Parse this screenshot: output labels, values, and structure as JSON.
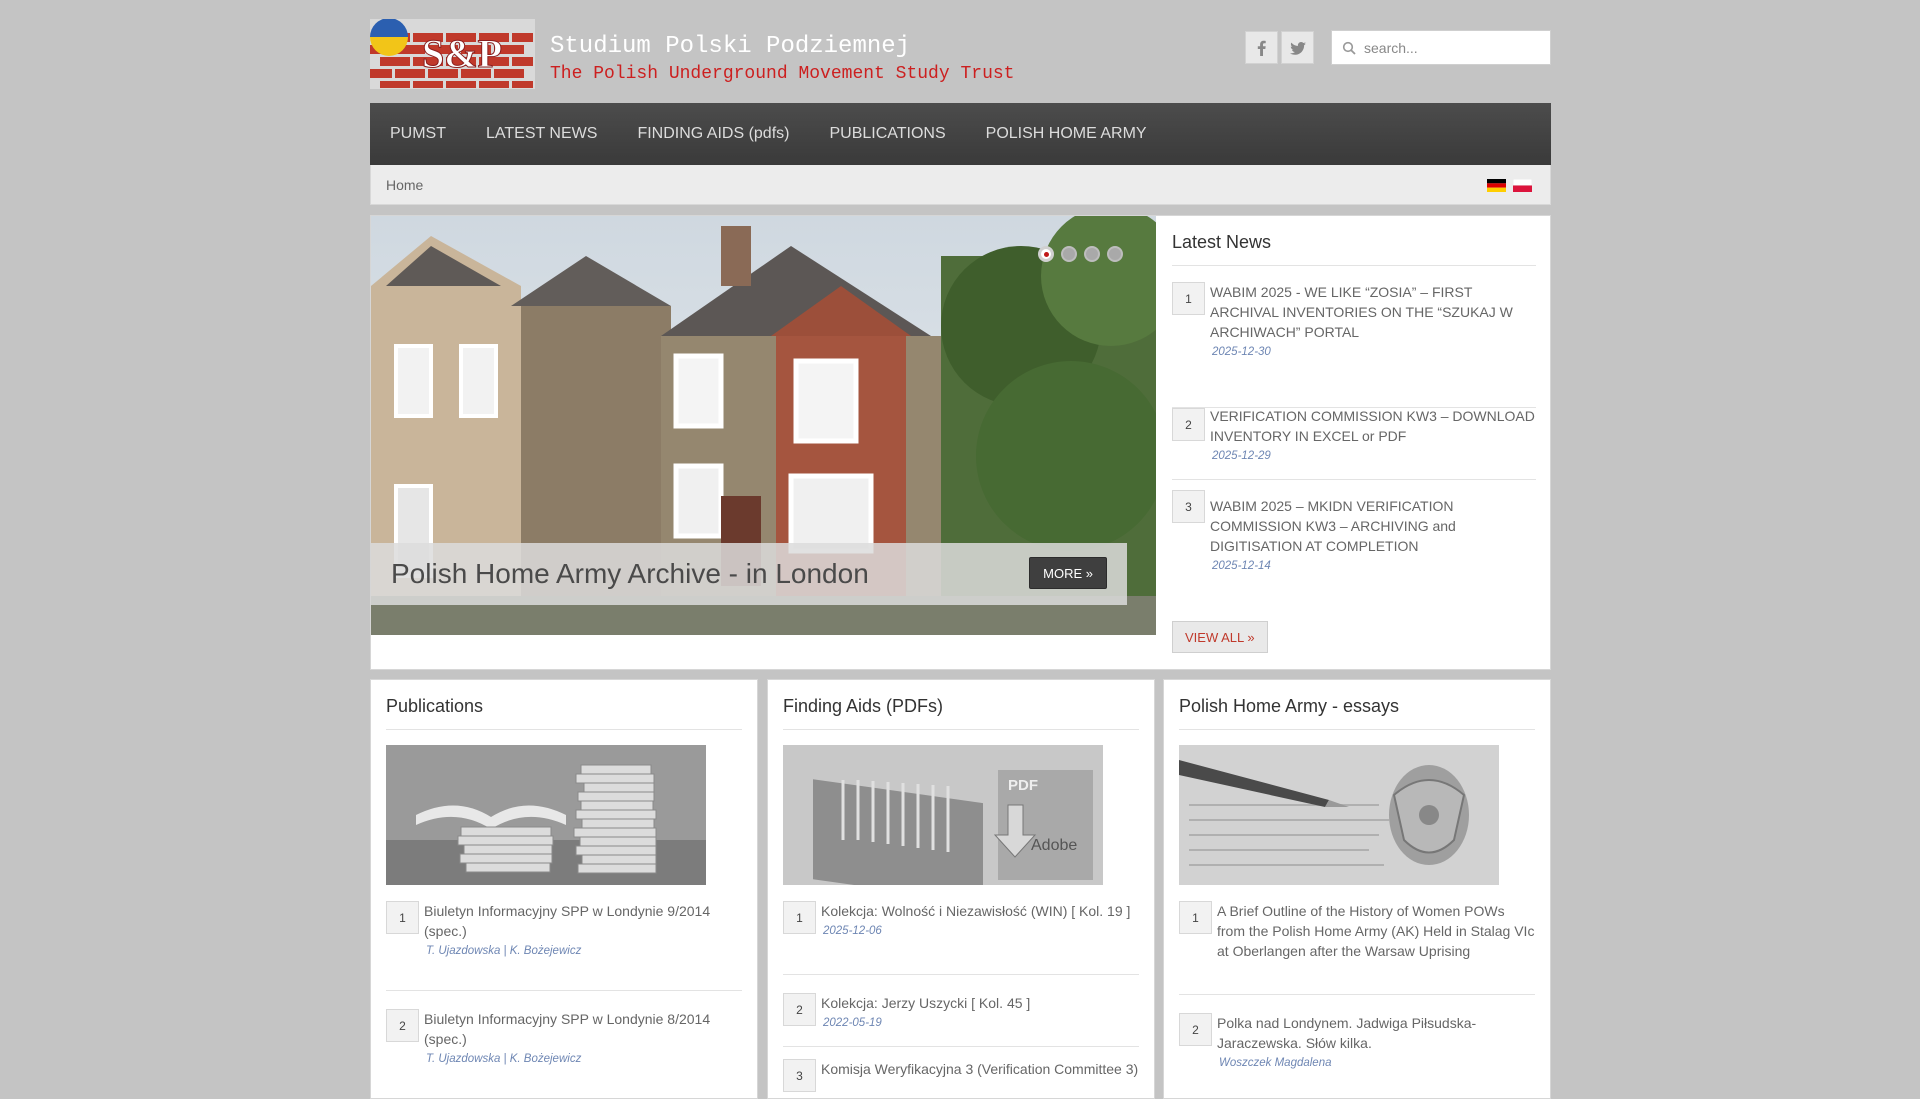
{
  "header": {
    "title": "Studium Polski Podziemnej",
    "subtitle": "The Polish Underground Movement Study Trust",
    "logo_text": "S&P",
    "search_placeholder": "search..."
  },
  "colors": {
    "brand_red": "#cc1f1f",
    "nav_bg": "#444444",
    "page_bg": "#c4c4c4",
    "meta_blue": "#6e86b3"
  },
  "social": [
    {
      "icon": "facebook-icon"
    },
    {
      "icon": "twitter-icon"
    }
  ],
  "nav": {
    "items": [
      "PUMST",
      "LATEST NEWS",
      "FINDING AIDS (pdfs)",
      "PUBLICATIONS",
      "POLISH HOME ARMY"
    ]
  },
  "breadcrumb": {
    "home": "Home"
  },
  "languages": [
    "de-flag-icon",
    "pl-flag-icon"
  ],
  "slider": {
    "caption": "Polish Home Army Archive - in London",
    "more_label": "MORE »",
    "slide_count": 4,
    "active_slide": 1
  },
  "latest_news": {
    "title": "Latest News",
    "items": [
      {
        "num": "1",
        "title": "WABIM 2025 - WE LIKE “ZOSIA” – FIRST ARCHIVAL INVENTORIES ON THE “SZUKAJ W ARCHIWACH” PORTAL",
        "date": "2025-12-30"
      },
      {
        "num": "2",
        "title": "VERIFICATION COMMISSION KW3 – DOWNLOAD INVENTORY IN EXCEL or PDF",
        "date": "2025-12-29"
      },
      {
        "num": "3",
        "title": "WABIM 2025 – MKIDN VERIFICATION COMMISSION KW3 – ARCHIVING and DIGITISATION AT COMPLETION",
        "date": "2025-12-14"
      }
    ],
    "view_all_label": "VIEW ALL »"
  },
  "publications": {
    "title": "Publications",
    "items": [
      {
        "num": "1",
        "title": "Biuletyn Informacyjny SPP w Londynie 9/2014 (spec.)",
        "meta": "T. Ujazdowska | K. Bożejewicz"
      },
      {
        "num": "2",
        "title": "Biuletyn Informacyjny SPP w Londynie 8/2014 (spec.)",
        "meta": "T. Ujazdowska | K. Bożejewicz"
      }
    ]
  },
  "finding_aids": {
    "title": "Finding Aids (PDFs)",
    "thumb_labels": [
      "PDF",
      "Adobe"
    ],
    "items": [
      {
        "num": "1",
        "title": "Kolekcja: Wolność i Niezawisłość (WIN) [ Kol. 19 ]",
        "meta": "2025-12-06"
      },
      {
        "num": "2",
        "title": "Kolekcja: Jerzy Uszycki [ Kol. 45 ]",
        "meta": "2022-05-19"
      },
      {
        "num": "3",
        "title": "Komisja Weryfikacyjna 3 (Verification Committee 3)",
        "meta": ""
      }
    ]
  },
  "home_army": {
    "title": "Polish Home Army - essays",
    "items": [
      {
        "num": "1",
        "title": "A Brief Outline of the History of Women POWs from the Polish Home Army (AK) Held in Stalag VIc at Oberlangen after the Warsaw Uprising",
        "meta": ""
      },
      {
        "num": "2",
        "title": "Polka nad Londynem. Jadwiga Piłsudska-Jaraczewska. Słów kilka.",
        "meta": "Woszczek Magdalena"
      }
    ]
  }
}
